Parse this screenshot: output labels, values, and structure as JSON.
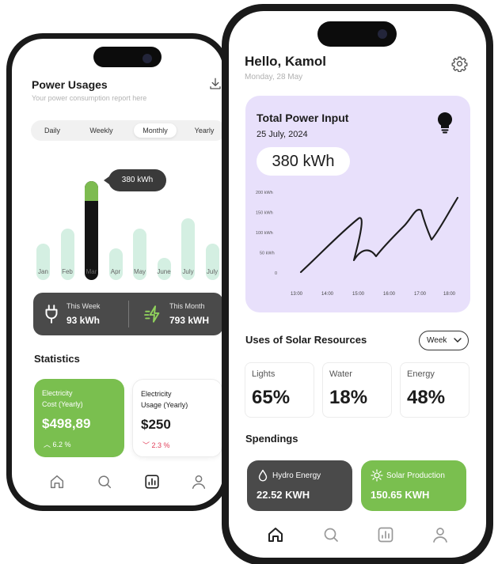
{
  "left_phone": {
    "header": {
      "title": "Power Usages",
      "subtitle": "Your power consumption report here"
    },
    "segments": [
      "Daily",
      "Weekly",
      "Monthly",
      "Yearly"
    ],
    "active_segment": "Monthly",
    "usage_chart": {
      "months": [
        "Jan",
        "Feb",
        "Mar",
        "Apr",
        "May",
        "June",
        "July",
        "July"
      ],
      "relative_levels": [
        0.37,
        0.52,
        1.0,
        0.32,
        0.52,
        0.22,
        0.62,
        0.37
      ],
      "selected_index": 2,
      "tooltip": "380 kWh"
    },
    "summary": {
      "this_week_label": "This Week",
      "this_week_value": "93 kWh",
      "this_month_label": "This Month",
      "this_month_value": "793 kWH"
    },
    "statistics": {
      "title": "Statistics",
      "cost": {
        "label_line1": "Electricity",
        "label_line2": "Cost (Yearly)",
        "value": "$498,89",
        "trend": "6.2 %"
      },
      "usage": {
        "label_line1": "Electricity",
        "label_line2": "Usage (Yearly)",
        "value": "$250",
        "trend": "2.3 %"
      }
    },
    "nav": [
      "home-icon",
      "search-icon",
      "chart-icon",
      "profile-icon"
    ]
  },
  "right_phone": {
    "header": {
      "greeting": "Hello, Kamol",
      "date": "Monday, 28 May"
    },
    "total_power": {
      "title": "Total Power Input",
      "date": "25 July, 2024",
      "value": "380 kWh",
      "y_ticks": [
        "200 kWh",
        "150 kWh",
        "100 kWh",
        "50 kWh",
        "0"
      ],
      "x_ticks": [
        "13:00",
        "14:00",
        "15:00",
        "16:00",
        "17:00",
        "18:00"
      ]
    },
    "solar": {
      "title": "Uses of Solar Resources",
      "period": "Week",
      "tiles": [
        {
          "label": "Lights",
          "value": "65%"
        },
        {
          "label": "Water",
          "value": "18%"
        },
        {
          "label": "Energy",
          "value": "48%"
        }
      ]
    },
    "spendings": {
      "title": "Spendings",
      "hydro": {
        "label": "Hydro Energy",
        "value": "22.52 KWH"
      },
      "solar": {
        "label": "Solar Production",
        "value": "150.65 KWH"
      }
    },
    "nav": [
      "home-icon",
      "search-icon",
      "chart-icon",
      "profile-icon"
    ]
  },
  "colors": {
    "accent_green": "#7abf4f",
    "dark_card": "#4a4a4a",
    "lavender_panel": "#e8e0fb",
    "bar_mint": "#d4efe2",
    "trend_down": "#e0405a"
  }
}
